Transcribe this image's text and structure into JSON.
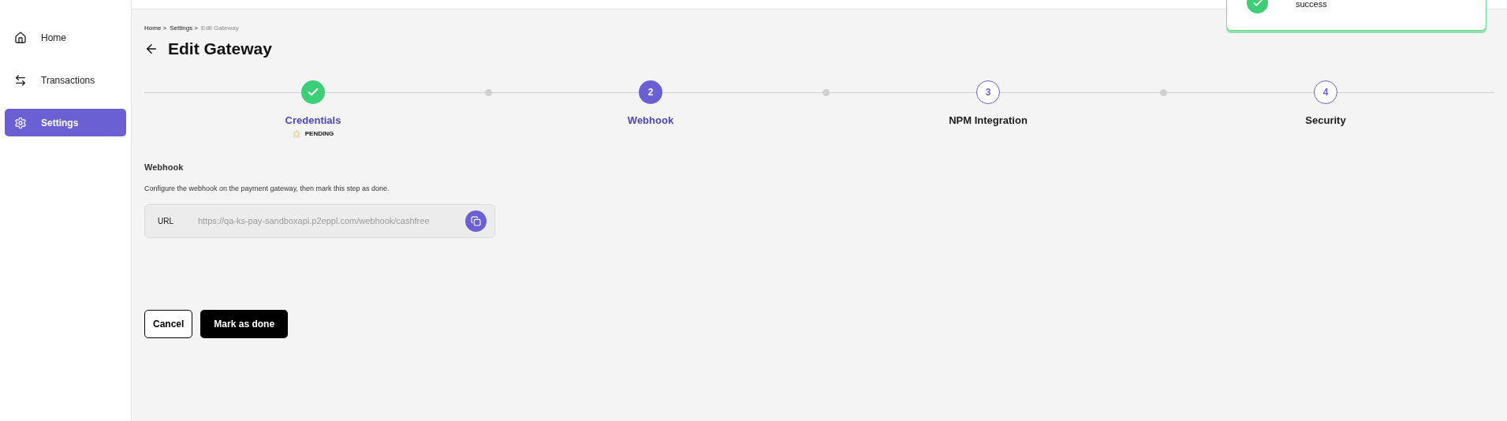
{
  "sidebar": {
    "items": [
      {
        "label": "Home",
        "selected": false
      },
      {
        "label": "Transactions",
        "selected": false
      },
      {
        "label": "Settings",
        "selected": true
      }
    ]
  },
  "toast": {
    "message": "success",
    "kind": "success"
  },
  "breadcrumb": [
    {
      "label": "Home >",
      "current": false
    },
    {
      "label": "Settings >",
      "current": false
    },
    {
      "label": "Edit Gateway",
      "current": true
    }
  ],
  "title": "Edit Gateway",
  "stepper": {
    "steps": [
      {
        "label": "Credentials",
        "kind": "done",
        "status": "PENDING"
      },
      {
        "label": "Webhook",
        "number": "2",
        "kind": "current"
      },
      {
        "label": "NPM Integration",
        "number": "3",
        "kind": "upcoming"
      },
      {
        "label": "Security",
        "number": "4",
        "kind": "upcoming"
      }
    ]
  },
  "section": {
    "heading": "Webhook",
    "description": "Configure the webhook on the payment gateway, then mark this step as done.",
    "url_label": "URL",
    "url_value": "https://qa-ks-pay-sandboxapi.p2eppl.com/webhook/cashfree"
  },
  "buttons": [
    {
      "label": "Cancel",
      "kind": "secondary"
    },
    {
      "label": "Mark as done",
      "kind": "primary"
    }
  ]
}
